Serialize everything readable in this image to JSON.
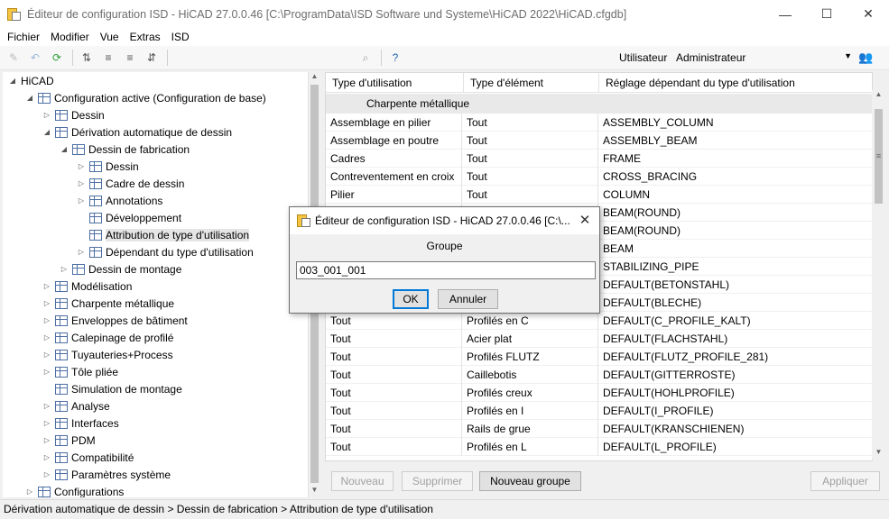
{
  "window": {
    "title": "Éditeur de configuration ISD  - HiCAD 27.0.0.46 [C:\\ProgramData\\ISD Software und Systeme\\HiCAD 2022\\HiCAD.cfgdb]",
    "controls": [
      "—",
      "☐",
      "✕"
    ]
  },
  "menu": [
    "Fichier",
    "Modifier",
    "Vue",
    "Extras",
    "ISD"
  ],
  "toolbar": {
    "icons": [
      "pencil-icon",
      "undo-icon",
      "refresh-icon",
      "sort-1-icon",
      "sort-2-icon",
      "sort-3-icon",
      "sort-4-icon",
      "binoculars-icon",
      "help-icon"
    ],
    "user_label": "Utilisateur",
    "user_value": "Administrateur"
  },
  "tree": [
    {
      "label": "HiCAD",
      "level": 0,
      "exp": "expanded",
      "icon": "none"
    },
    {
      "label": "Configuration active (Configuration de base)",
      "level": 1,
      "exp": "expanded",
      "icon": "cfg"
    },
    {
      "label": "Dessin",
      "level": 2,
      "exp": "collapsed",
      "icon": "cfg"
    },
    {
      "label": "Dérivation automatique de dessin",
      "level": 2,
      "exp": "expanded",
      "icon": "cfg"
    },
    {
      "label": "Dessin de fabrication",
      "level": 3,
      "exp": "expanded",
      "icon": "cfg"
    },
    {
      "label": "Dessin",
      "level": 4,
      "exp": "collapsed",
      "icon": "cfg"
    },
    {
      "label": "Cadre de dessin",
      "level": 4,
      "exp": "collapsed",
      "icon": "cfg"
    },
    {
      "label": "Annotations",
      "level": 4,
      "exp": "collapsed",
      "icon": "cfg"
    },
    {
      "label": "Développement",
      "level": 4,
      "exp": "none",
      "icon": "cfg"
    },
    {
      "label": "Attribution de type d'utilisation",
      "level": 4,
      "exp": "none",
      "icon": "cfg",
      "selected": true
    },
    {
      "label": "Dépendant du type d'utilisation",
      "level": 4,
      "exp": "collapsed",
      "icon": "cfg"
    },
    {
      "label": "Dessin de montage",
      "level": 3,
      "exp": "collapsed",
      "icon": "cfg"
    },
    {
      "label": "Modélisation",
      "level": 2,
      "exp": "collapsed",
      "icon": "cfg"
    },
    {
      "label": "Charpente métallique",
      "level": 2,
      "exp": "collapsed",
      "icon": "cfg"
    },
    {
      "label": "Enveloppes de bâtiment",
      "level": 2,
      "exp": "collapsed",
      "icon": "cfg"
    },
    {
      "label": "Calepinage de profilé",
      "level": 2,
      "exp": "collapsed",
      "icon": "cfg"
    },
    {
      "label": "Tuyauteries+Process",
      "level": 2,
      "exp": "collapsed",
      "icon": "cfg"
    },
    {
      "label": "Tôle pliée",
      "level": 2,
      "exp": "collapsed",
      "icon": "cfg"
    },
    {
      "label": "Simulation de montage",
      "level": 2,
      "exp": "none",
      "icon": "cfg"
    },
    {
      "label": "Analyse",
      "level": 2,
      "exp": "collapsed",
      "icon": "cfg"
    },
    {
      "label": "Interfaces",
      "level": 2,
      "exp": "collapsed",
      "icon": "cfg"
    },
    {
      "label": "PDM",
      "level": 2,
      "exp": "collapsed",
      "icon": "cfg"
    },
    {
      "label": "Compatibilité",
      "level": 2,
      "exp": "collapsed",
      "icon": "cfg"
    },
    {
      "label": "Paramètres système",
      "level": 2,
      "exp": "collapsed",
      "icon": "cfg"
    },
    {
      "label": "Configurations",
      "level": 1,
      "exp": "collapsed",
      "icon": "cfg"
    }
  ],
  "grid": {
    "columns": [
      "Type d'utilisation",
      "Type d'élément",
      "Réglage dépendant du type d'utilisation"
    ],
    "group": "Charpente métallique",
    "rows": [
      [
        "Assemblage en pilier",
        "Tout",
        "ASSEMBLY_COLUMN"
      ],
      [
        "Assemblage en poutre",
        "Tout",
        "ASSEMBLY_BEAM"
      ],
      [
        "Cadres",
        "Tout",
        "FRAME"
      ],
      [
        "Contreventement en croix",
        "Tout",
        "CROSS_BRACING"
      ],
      [
        "Pilier",
        "Tout",
        "COLUMN"
      ],
      [
        "",
        "",
        "BEAM(ROUND)"
      ],
      [
        "",
        "",
        "BEAM(ROUND)"
      ],
      [
        "",
        "",
        "BEAM"
      ],
      [
        "",
        "",
        "STABILIZING_PIPE"
      ],
      [
        "",
        "",
        "DEFAULT(BETONSTAHL)"
      ],
      [
        "",
        "",
        "DEFAULT(BLECHE)"
      ],
      [
        "Tout",
        "Profilés en C",
        "DEFAULT(C_PROFILE_KALT)"
      ],
      [
        "Tout",
        "Acier plat",
        "DEFAULT(FLACHSTAHL)"
      ],
      [
        "Tout",
        "Profilés FLUTZ",
        "DEFAULT(FLUTZ_PROFILE_281)"
      ],
      [
        "Tout",
        "Caillebotis",
        "DEFAULT(GITTERROSTE)"
      ],
      [
        "Tout",
        "Profilés creux",
        "DEFAULT(HOHLPROFILE)"
      ],
      [
        "Tout",
        "Profilés en I",
        "DEFAULT(I_PROFILE)"
      ],
      [
        "Tout",
        "Rails de grue",
        "DEFAULT(KRANSCHIENEN)"
      ],
      [
        "Tout",
        "Profilés en L",
        "DEFAULT(L_PROFILE)"
      ]
    ]
  },
  "buttons": {
    "new": "Nouveau",
    "delete": "Supprimer",
    "new_group": "Nouveau groupe",
    "apply": "Appliquer"
  },
  "status": "Dérivation automatique de dessin > Dessin de fabrication > Attribution de type d'utilisation",
  "dialog": {
    "title": "Éditeur de configuration ISD  - HiCAD 27.0.0.46 [C:\\...",
    "label": "Groupe",
    "value": "003_001_001",
    "ok": "OK",
    "cancel": "Annuler"
  }
}
